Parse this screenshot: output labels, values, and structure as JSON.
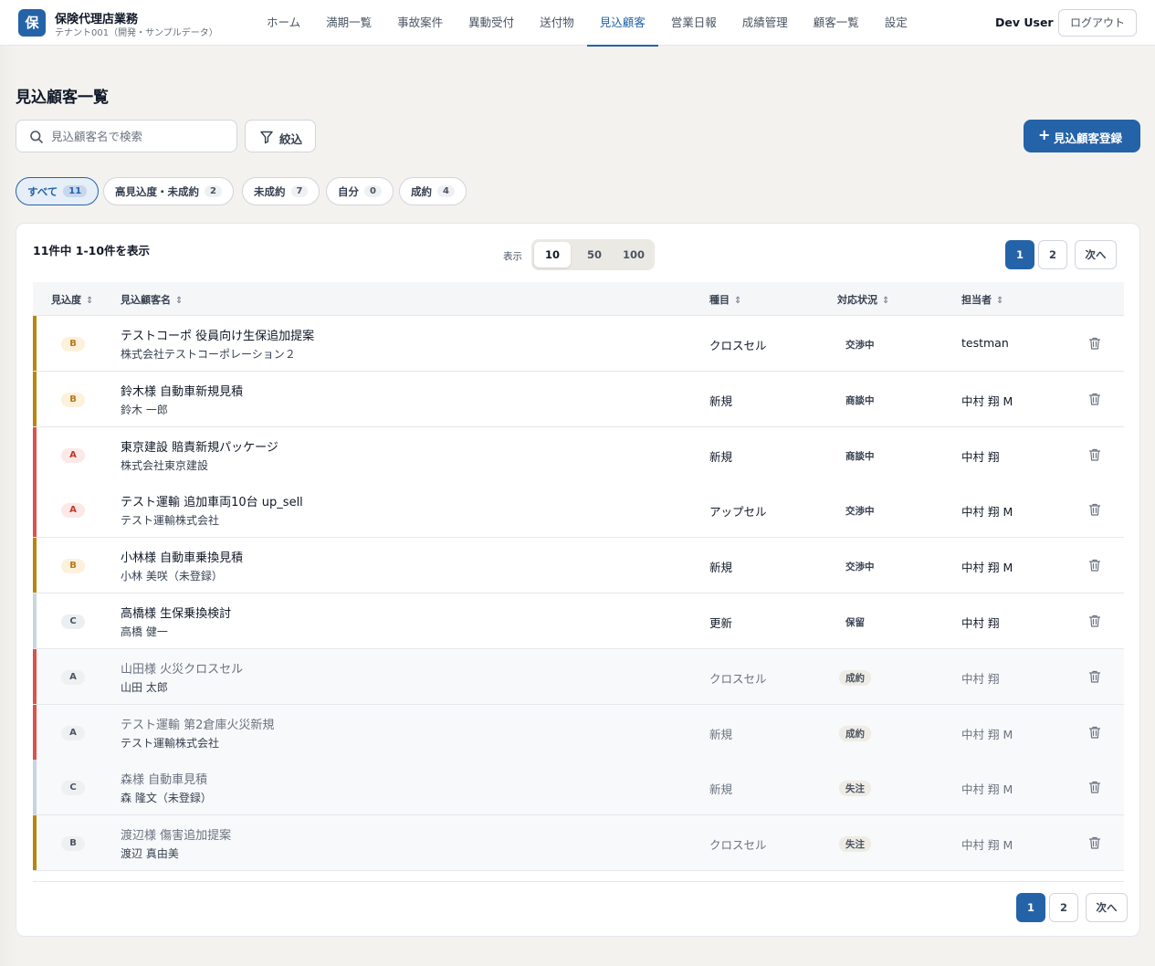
{
  "header": {
    "logo_char": "保",
    "brand_title": "保険代理店業務",
    "brand_sub": "テナント001（開発・サンプルデータ）",
    "nav": [
      {
        "label": "ホーム",
        "active": false
      },
      {
        "label": "満期一覧",
        "active": false
      },
      {
        "label": "事故案件",
        "active": false
      },
      {
        "label": "異動受付",
        "active": false
      },
      {
        "label": "送付物",
        "active": false
      },
      {
        "label": "見込顧客",
        "active": true
      },
      {
        "label": "営業日報",
        "active": false
      },
      {
        "label": "成績管理",
        "active": false
      },
      {
        "label": "顧客一覧",
        "active": false
      },
      {
        "label": "設定",
        "active": false
      }
    ],
    "user_name": "Dev User",
    "logout_label": "ログアウト"
  },
  "page": {
    "title": "見込顧客一覧",
    "search_placeholder": "見込顧客名で検索",
    "filter_label": "絞込",
    "register_label": "見込顧客登録"
  },
  "chips": [
    {
      "label": "すべて",
      "count": "11",
      "active": true
    },
    {
      "label": "高見込度・未成約",
      "count": "2",
      "active": false
    },
    {
      "label": "未成約",
      "count": "7",
      "active": false
    },
    {
      "label": "自分",
      "count": "0",
      "active": false
    },
    {
      "label": "成約",
      "count": "4",
      "active": false
    }
  ],
  "list": {
    "result_text": "11件中 1-10件を表示",
    "perpage_label": "表示",
    "perpage_options": [
      "10",
      "50",
      "100"
    ],
    "perpage_selected": "10",
    "pagination": {
      "pages": [
        "1",
        "2"
      ],
      "current": "1",
      "next_label": "次へ"
    },
    "columns": {
      "level": "見込度",
      "name": "見込顧客名",
      "type": "種目",
      "status": "対応状況",
      "owner": "担当者"
    },
    "rows": [
      {
        "level": "B",
        "name": "テストコーポ 役員向け生保追加提案",
        "sub": "株式会社テストコーポレーション２",
        "type": "クロスセル",
        "status": "交渉中",
        "owner": "testman",
        "closed": false
      },
      {
        "level": "B",
        "name": "鈴木様 自動車新規見積",
        "sub": "鈴木 一郎",
        "type": "新規",
        "status": "商談中",
        "owner": "中村 翔 M",
        "closed": false
      },
      {
        "level": "A",
        "name": "東京建設 賠責新規パッケージ",
        "sub": "株式会社東京建設",
        "type": "新規",
        "status": "商談中",
        "owner": "中村 翔",
        "closed": false
      },
      {
        "level": "A",
        "name": "テスト運輸 追加車両10台 up_sell",
        "sub": "テスト運輸株式会社",
        "type": "アップセル",
        "status": "交渉中",
        "owner": "中村 翔 M",
        "closed": false
      },
      {
        "level": "B",
        "name": "小林様 自動車乗換見積",
        "sub": "小林 美咲（未登録）",
        "type": "新規",
        "status": "交渉中",
        "owner": "中村 翔 M",
        "closed": false
      },
      {
        "level": "C",
        "name": "高橋様 生保乗換検討",
        "sub": "高橋 健一",
        "type": "更新",
        "status": "保留",
        "owner": "中村 翔",
        "closed": false
      },
      {
        "level": "A",
        "name": "山田様 火災クロスセル",
        "sub": "山田 太郎",
        "type": "クロスセル",
        "status": "成約",
        "owner": "中村 翔",
        "closed": true
      },
      {
        "level": "A",
        "name": "テスト運輸 第2倉庫火災新規",
        "sub": "テスト運輸株式会社",
        "type": "新規",
        "status": "成約",
        "owner": "中村 翔 M",
        "closed": true
      },
      {
        "level": "C",
        "name": "森様 自動車見積",
        "sub": "森 隆文（未登録）",
        "type": "新規",
        "status": "失注",
        "owner": "中村 翔 M",
        "closed": true
      },
      {
        "level": "B",
        "name": "渡辺様 傷害追加提案",
        "sub": "渡辺 真由美",
        "type": "クロスセル",
        "status": "失注",
        "owner": "中村 翔 M",
        "closed": true
      }
    ]
  },
  "colors": {
    "accent": "#2563a8",
    "level_A": "#d9534f",
    "level_B": "#b8860b",
    "level_C": "#c7d5df"
  },
  "icons": {
    "search": "search-icon",
    "filter": "filter-icon",
    "plus": "plus-icon",
    "trash": "trash-icon",
    "sort": "sort-icon"
  }
}
